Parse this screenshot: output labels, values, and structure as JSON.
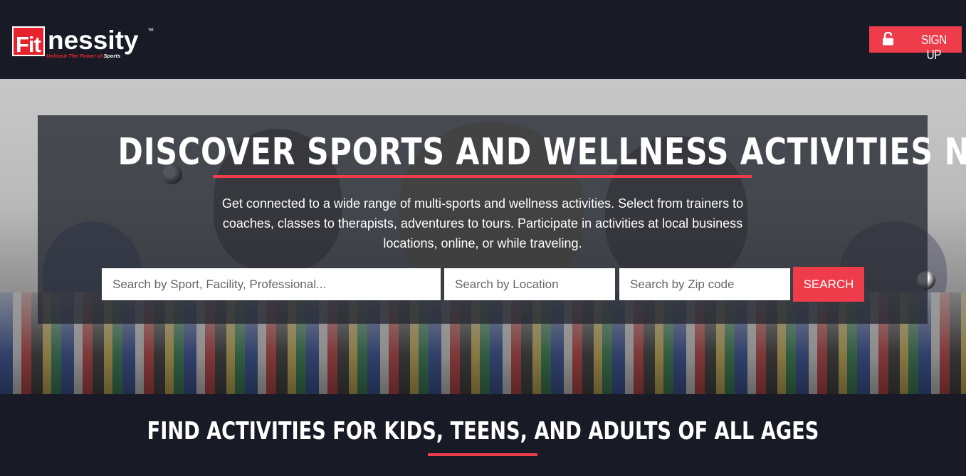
{
  "header": {
    "logo": {
      "fit": "Fit",
      "rest": "nessity",
      "tm": "™",
      "tagline_red": "Unleash The Power of",
      "tagline_white": "Sports"
    },
    "signup_label": "SIGN UP",
    "signup_icon": "unlock-icon"
  },
  "hero": {
    "title": "DISCOVER SPORTS AND WELLNESS ACTIVITIES NEAR YOU",
    "description": "Get connected to a wide range of multi-sports and wellness activities. Select from trainers to coaches, classes to therapists, adventures to tours. Participate in activities at local business locations, online, or while traveling.",
    "search": {
      "sport_placeholder": "Search by Sport, Facility, Professional...",
      "location_placeholder": "Search by Location",
      "zip_placeholder": "Search by Zip code",
      "button_label": "SEARCH"
    }
  },
  "section": {
    "title": "FIND ACTIVITIES FOR KIDS, TEENS, AND ADULTS OF ALL AGES"
  },
  "colors": {
    "accent": "#ef3c4b",
    "background": "#181a26",
    "logo_red": "#e6232d"
  }
}
